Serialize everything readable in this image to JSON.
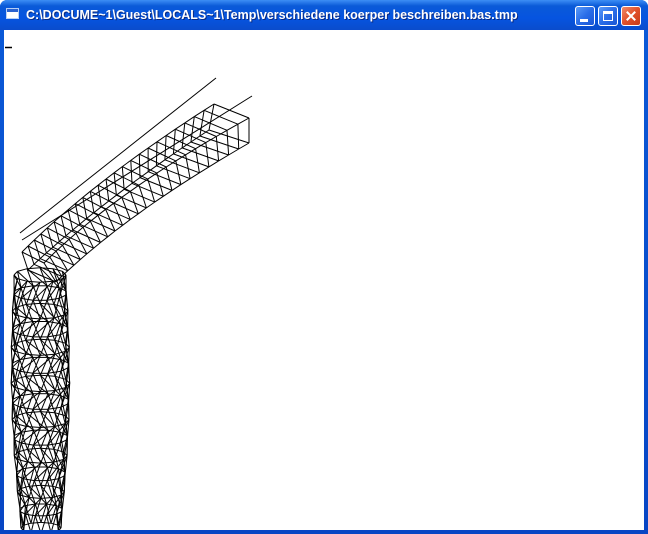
{
  "window": {
    "title": "C:\\DOCUME~1\\Guest\\LOCALS~1\\Temp\\verschiedene koerper beschreiben.bas.tmp",
    "controls": {
      "minimize_icon": "minimize-icon",
      "maximize_icon": "maximize-icon",
      "close_icon": "close-icon"
    }
  },
  "canvas": {
    "background": "#ffffff",
    "line_color": "#000000",
    "drawings": [
      "curved-box-wireframe",
      "cylinder-wireframe"
    ]
  },
  "colors": {
    "titlebar": "#0a5ad8",
    "close_button": "#e0502a"
  }
}
